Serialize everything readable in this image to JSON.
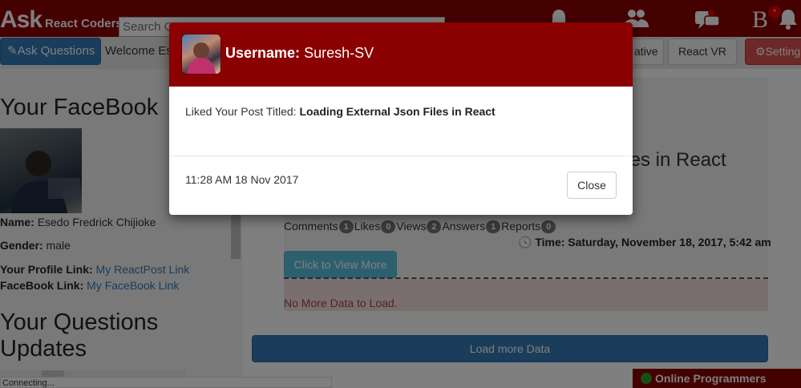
{
  "topbar": {
    "brand_main": "Ask",
    "brand_sub": "React Coders",
    "search_placeholder": "Search Q",
    "brand_letter": "B",
    "notif_count": "*"
  },
  "nav": {
    "ask_button": "Ask Questions",
    "welcome": "Welcome Esc",
    "native": "ative",
    "react_vr": "React VR",
    "settings": "Setting"
  },
  "profile": {
    "heading": "Your FaceBook",
    "name_label": "Name:",
    "name_value": "Esedo Fredrick Chijioke",
    "gender_label": "Gender:",
    "gender_value": "male",
    "profile_link_label": "Your Profile Link:",
    "profile_link_text": "My ReactPost Link",
    "facebook_link_label": "FaceBook Link:",
    "facebook_link_text": "My FaceBook Link",
    "questions_heading": "Your Questions Updates",
    "status_text": "Connecting..."
  },
  "post": {
    "title_fragment": "iles in React",
    "comments_label": "Comments",
    "comments_count": "1",
    "likes_label": "Likes",
    "likes_count": "0",
    "views_label": "Views",
    "views_count": "2",
    "answers_label": "Answers",
    "answers_count": "1",
    "reports_label": "Reports",
    "reports_count": "0",
    "time_text": "Time: Saturday, November 18, 2017, 5:42 am",
    "view_more": "Click to View More",
    "no_more": "No More Data to Load."
  },
  "load_more": "Load more Data",
  "online": "Online Programmers",
  "online_dot": "*",
  "modal": {
    "username_label": "Username:",
    "username": "Suresh-SV",
    "body_prefix": "Liked Your Post Titled:",
    "post_title": "Loading External Json Files in React",
    "time": "11:28 AM 18 Nov 2017",
    "close": "Close"
  }
}
